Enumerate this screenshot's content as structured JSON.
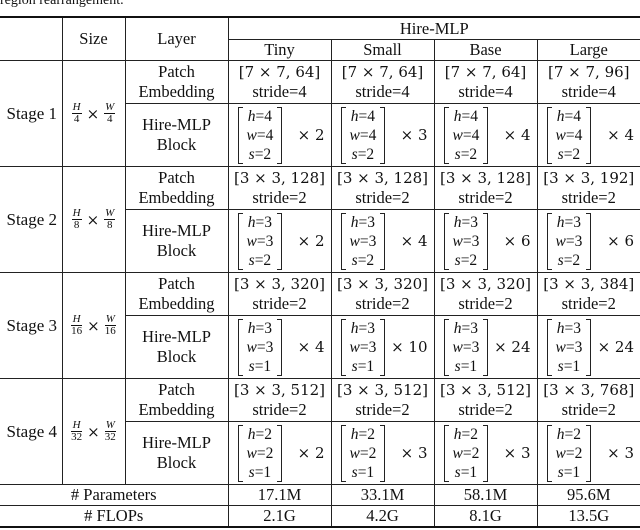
{
  "caption": "region rearrangement.",
  "table": {
    "header": {
      "size": "Size",
      "layer": "Layer",
      "model_group": "Hire-MLP",
      "variants": [
        "Tiny",
        "Small",
        "Base",
        "Large"
      ]
    },
    "layer_names": {
      "patch_line1": "Patch",
      "patch_line2": "Embedding",
      "block_line1": "Hire-MLP",
      "block_line2": "Block"
    },
    "labels": {
      "times": "×",
      "h": "h",
      "w": "w",
      "s": "s",
      "H": "H",
      "W": "W"
    },
    "stages": [
      {
        "name": "Stage 1",
        "downsample": "4",
        "patch_embedding": [
          {
            "kernel": "[7 × 7, 64]",
            "stride": "stride=4"
          },
          {
            "kernel": "[7 × 7, 64]",
            "stride": "stride=4"
          },
          {
            "kernel": "[7 × 7, 64]",
            "stride": "stride=4"
          },
          {
            "kernel": "[7 × 7, 96]",
            "stride": "stride=4"
          }
        ],
        "blocks": [
          {
            "h": "=4",
            "w": "=4",
            "s": "=2",
            "repeat": "× 2"
          },
          {
            "h": "=4",
            "w": "=4",
            "s": "=2",
            "repeat": "× 3"
          },
          {
            "h": "=4",
            "w": "=4",
            "s": "=2",
            "repeat": "× 4"
          },
          {
            "h": "=4",
            "w": "=4",
            "s": "=2",
            "repeat": "× 4"
          }
        ]
      },
      {
        "name": "Stage 2",
        "downsample": "8",
        "patch_embedding": [
          {
            "kernel": "[3 × 3, 128]",
            "stride": "stride=2"
          },
          {
            "kernel": "[3 × 3, 128]",
            "stride": "stride=2"
          },
          {
            "kernel": "[3 × 3, 128]",
            "stride": "stride=2"
          },
          {
            "kernel": "[3 × 3, 192]",
            "stride": "stride=2"
          }
        ],
        "blocks": [
          {
            "h": "=3",
            "w": "=3",
            "s": "=2",
            "repeat": "× 2"
          },
          {
            "h": "=3",
            "w": "=3",
            "s": "=2",
            "repeat": "× 4"
          },
          {
            "h": "=3",
            "w": "=3",
            "s": "=2",
            "repeat": "× 6"
          },
          {
            "h": "=3",
            "w": "=3",
            "s": "=2",
            "repeat": "× 6"
          }
        ]
      },
      {
        "name": "Stage 3",
        "downsample": "16",
        "patch_embedding": [
          {
            "kernel": "[3 × 3, 320]",
            "stride": "stride=2"
          },
          {
            "kernel": "[3 × 3, 320]",
            "stride": "stride=2"
          },
          {
            "kernel": "[3 × 3, 320]",
            "stride": "stride=2"
          },
          {
            "kernel": "[3 × 3, 384]",
            "stride": "stride=2"
          }
        ],
        "blocks": [
          {
            "h": "=3",
            "w": "=3",
            "s": "=1",
            "repeat": "× 4"
          },
          {
            "h": "=3",
            "w": "=3",
            "s": "=1",
            "repeat": "× 10"
          },
          {
            "h": "=3",
            "w": "=3",
            "s": "=1",
            "repeat": "× 24"
          },
          {
            "h": "=3",
            "w": "=3",
            "s": "=1",
            "repeat": "× 24"
          }
        ]
      },
      {
        "name": "Stage 4",
        "downsample": "32",
        "patch_embedding": [
          {
            "kernel": "[3 × 3, 512]",
            "stride": "stride=2"
          },
          {
            "kernel": "[3 × 3, 512]",
            "stride": "stride=2"
          },
          {
            "kernel": "[3 × 3, 512]",
            "stride": "stride=2"
          },
          {
            "kernel": "[3 × 3, 768]",
            "stride": "stride=2"
          }
        ],
        "blocks": [
          {
            "h": "=2",
            "w": "=2",
            "s": "=1",
            "repeat": "× 2"
          },
          {
            "h": "=2",
            "w": "=2",
            "s": "=1",
            "repeat": "× 3"
          },
          {
            "h": "=2",
            "w": "=2",
            "s": "=1",
            "repeat": "× 3"
          },
          {
            "h": "=2",
            "w": "=2",
            "s": "=1",
            "repeat": "× 3"
          }
        ]
      }
    ],
    "summary": [
      {
        "label": "# Parameters",
        "values": [
          "17.1M",
          "33.1M",
          "58.1M",
          "95.6M"
        ]
      },
      {
        "label": "# FLOPs",
        "values": [
          "2.1G",
          "4.2G",
          "8.1G",
          "13.5G"
        ]
      }
    ]
  }
}
